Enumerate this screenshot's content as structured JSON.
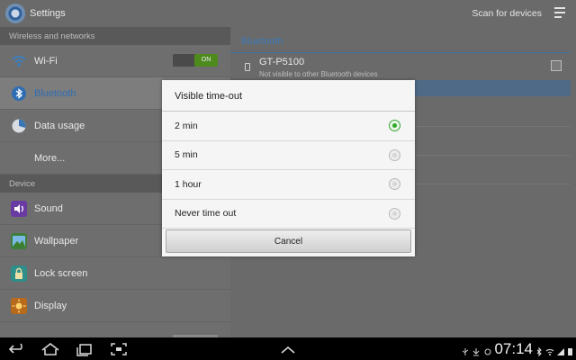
{
  "action_bar": {
    "title": "Settings",
    "scan_label": "Scan for devices",
    "icon": "settings-gear-icon"
  },
  "left_pane": {
    "sections": [
      {
        "header": "Wireless and networks",
        "items": [
          {
            "label": "Wi-Fi",
            "icon": "wifi-icon",
            "toggle": "ON"
          },
          {
            "label": "Bluetooth",
            "icon": "bluetooth-icon",
            "selected": true
          },
          {
            "label": "Data usage",
            "icon": "data-usage-icon"
          },
          {
            "label": "More...",
            "icon": ""
          }
        ]
      },
      {
        "header": "Device",
        "items": [
          {
            "label": "Sound",
            "icon": "sound-icon"
          },
          {
            "label": "Wallpaper",
            "icon": "wallpaper-icon"
          },
          {
            "label": "Lock screen",
            "icon": "lock-icon"
          },
          {
            "label": "Display",
            "icon": "display-icon"
          }
        ]
      }
    ]
  },
  "right_pane": {
    "title": "Bluetooth",
    "device": {
      "name": "GT-P5100",
      "status": "Not visible to other Bluetooth devices",
      "checked": false
    }
  },
  "dialog": {
    "title": "Visible time-out",
    "options": [
      {
        "label": "2 min",
        "selected": true
      },
      {
        "label": "5 min",
        "selected": false
      },
      {
        "label": "1 hour",
        "selected": false
      },
      {
        "label": "Never time out",
        "selected": false
      }
    ],
    "cancel_label": "Cancel"
  },
  "system_bar": {
    "time": "07:14",
    "nav_icons": [
      "back-icon",
      "home-icon",
      "recent-apps-icon",
      "screenshot-icon"
    ],
    "colors": {
      "accent": "#2eaa2a",
      "bluetooth_blue": "#3d79b8"
    }
  }
}
